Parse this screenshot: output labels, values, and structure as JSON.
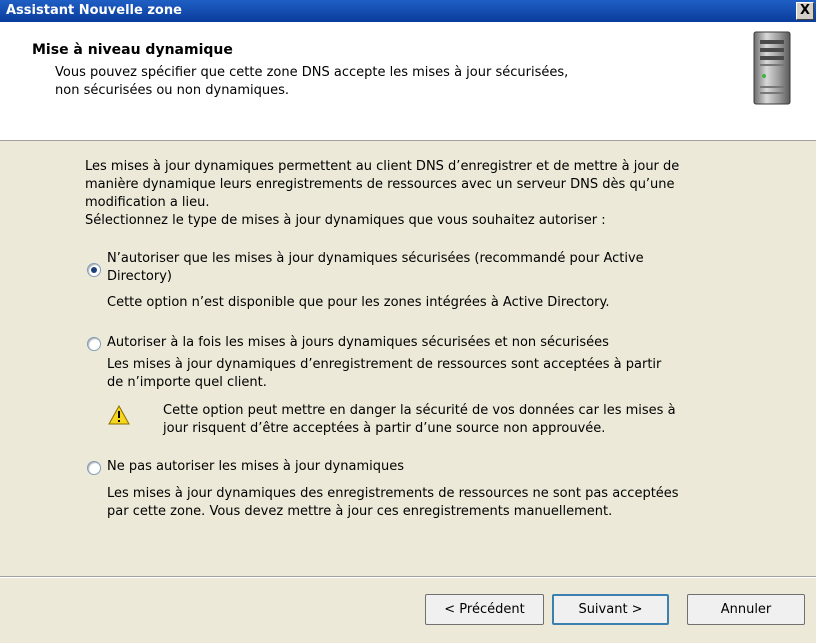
{
  "window": {
    "title": "Assistant Nouvelle zone",
    "close_label": "X"
  },
  "header": {
    "title": "Mise à niveau dynamique",
    "desc_line1": "Vous pouvez spécifier que cette zone DNS accepte les mises à jour sécurisées,",
    "desc_line2": "non sécurisées ou non dynamiques."
  },
  "intro": {
    "line1": "Les mises à jour dynamiques permettent au client DNS d’enregistrer et de mettre à jour de",
    "line2": "manière dynamique leurs enregistrements de ressources avec un serveur DNS dès qu’une",
    "line3": "modification a lieu.",
    "line4": "Sélectionnez le type de mises à jour dynamiques que vous souhaitez autoriser :"
  },
  "options": [
    {
      "label_line1": "N’autoriser que les mises à jour dynamiques sécurisées (recommandé pour Active",
      "label_line2": "Directory)",
      "desc_line1": "Cette option n’est disponible que pour les zones intégrées à Active Directory.",
      "checked": true
    },
    {
      "label_line1": "Autoriser à la fois les mises à jours dynamiques sécurisées et non sécurisées",
      "desc_line1": "Les mises à jour dynamiques d’enregistrement de ressources sont acceptées à partir",
      "desc_line2": "de n’importe quel client.",
      "warning_line1": "Cette option peut mettre en danger la sécurité de vos données car les mises à",
      "warning_line2": "jour risquent d’être acceptées à partir d’une source non approuvée.",
      "checked": false
    },
    {
      "label_line1": "Ne pas autoriser les mises à jour dynamiques",
      "desc_line1": "Les mises à jour dynamiques des enregistrements de ressources ne sont pas acceptées",
      "desc_line2": "par cette zone. Vous devez mettre à jour ces enregistrements manuellement.",
      "checked": false
    }
  ],
  "buttons": {
    "back": "< Précédent",
    "next": "Suivant >",
    "cancel": "Annuler"
  },
  "icons": {
    "header": "server-icon",
    "warning": "warning-icon"
  },
  "colors": {
    "titlebar": "#0a3c9c",
    "dialog_bg": "#ece9d8",
    "warning": "#f5d51e"
  }
}
